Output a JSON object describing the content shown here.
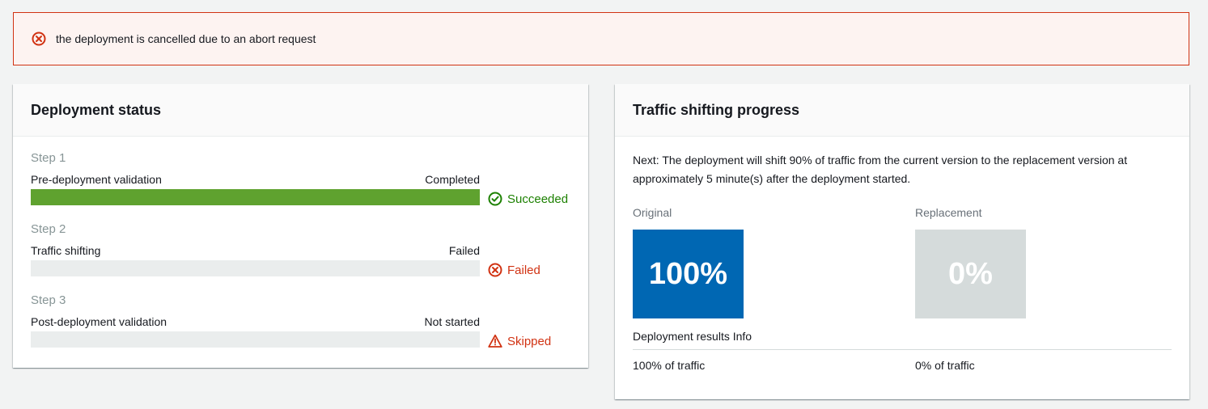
{
  "alert": {
    "icon": "error-circle-x-icon",
    "message": "the deployment is cancelled due to an abort request",
    "color": "#d13212"
  },
  "deployment_status": {
    "title": "Deployment status",
    "steps": [
      {
        "step_label": "Step 1",
        "name": "Pre-deployment validation",
        "state": "Completed",
        "progress": 1.0,
        "result": "Succeeded",
        "result_icon": "check-circle-icon",
        "result_color": "#1d8102"
      },
      {
        "step_label": "Step 2",
        "name": "Traffic shifting",
        "state": "Failed",
        "progress": 0.0,
        "result": "Failed",
        "result_icon": "x-circle-icon",
        "result_color": "#d13212"
      },
      {
        "step_label": "Step 3",
        "name": "Post-deployment validation",
        "state": "Not started",
        "progress": 0.0,
        "result": "Skipped",
        "result_icon": "warning-triangle-icon",
        "result_color": "#d13212"
      }
    ],
    "progress_color": "#5fa22f"
  },
  "traffic": {
    "title": "Traffic shifting progress",
    "next_text": "Next: The deployment will shift 90% of traffic from the current version to the replacement version at approximately 5 minute(s) after the deployment started.",
    "original": {
      "label": "Original",
      "percent": "100%",
      "color": "#0067b3",
      "traffic": "100% of traffic"
    },
    "replacement": {
      "label": "Replacement",
      "percent": "0%",
      "color": "#d5dbdb",
      "traffic": "0% of traffic"
    },
    "results_title": "Deployment results Info"
  }
}
